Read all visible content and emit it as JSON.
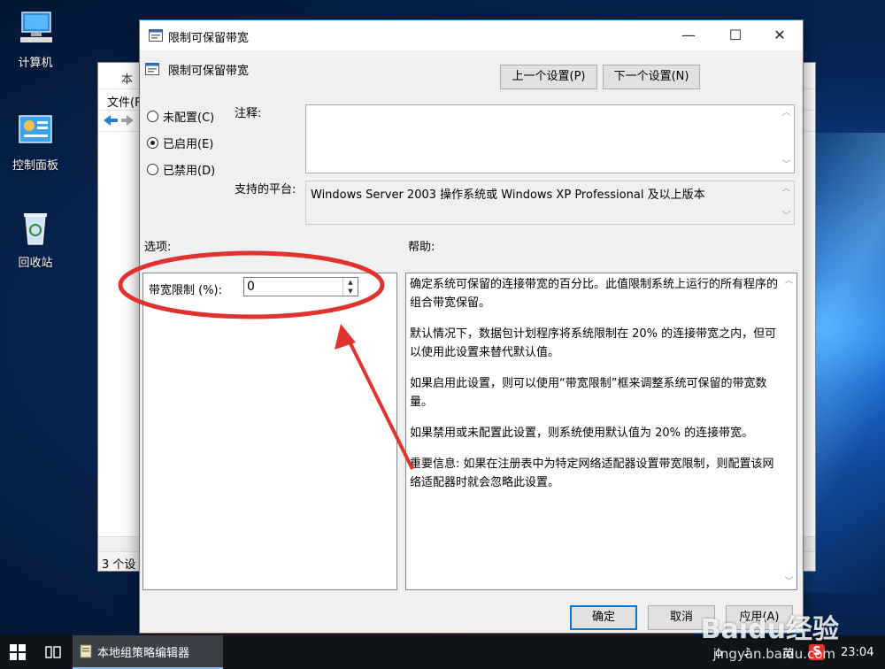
{
  "desktop": {
    "icons": [
      {
        "label": "计算机"
      },
      {
        "label": "控制面板"
      },
      {
        "label": "回收站"
      }
    ]
  },
  "bg_window": {
    "title": "本",
    "menu": "文件(F",
    "status": "3 个设"
  },
  "dialog": {
    "title": "限制可保留带宽",
    "header_title": "限制可保留带宽",
    "prev_button": "上一个设置(P)",
    "next_button": "下一个设置(N)",
    "radio_options": [
      {
        "label": "未配置(C)",
        "checked": false
      },
      {
        "label": "已启用(E)",
        "checked": true
      },
      {
        "label": "已禁用(D)",
        "checked": false
      }
    ],
    "comment_label": "注释:",
    "comment_value": "",
    "platform_label": "支持的平台:",
    "platform_value": "Windows Server 2003 操作系统或 Windows XP Professional 及以上版本",
    "options_label": "选项:",
    "help_label": "帮助:",
    "bandwidth_label": "带宽限制 (%):",
    "bandwidth_value": "0",
    "help_paragraphs": [
      "确定系统可保留的连接带宽的百分比。此值限制系统上运行的所有程序的组合带宽保留。",
      "默认情况下，数据包计划程序将系统限制在 20% 的连接带宽之内，但可以使用此设置来替代默认值。",
      "如果启用此设置，则可以使用“带宽限制”框来调整系统可保留的带宽数量。",
      "如果禁用或未配置此设置，则系统使用默认值为 20% 的连接带宽。",
      "重要信息: 如果在注册表中为特定网络适配器设置带宽限制，则配置该网络适配器时就会忽略此设置。"
    ],
    "ok_button": "确定",
    "cancel_button": "取消",
    "apply_button": "应用(A)"
  },
  "taskbar": {
    "app_label": "本地组策略编辑器",
    "ime": "英",
    "time": "23:04"
  },
  "watermark": {
    "brand": "Baidu经验",
    "site": "jingyan.baidu.com"
  },
  "colors": {
    "accent": "#0078d7",
    "annotation": "#e0322f"
  }
}
